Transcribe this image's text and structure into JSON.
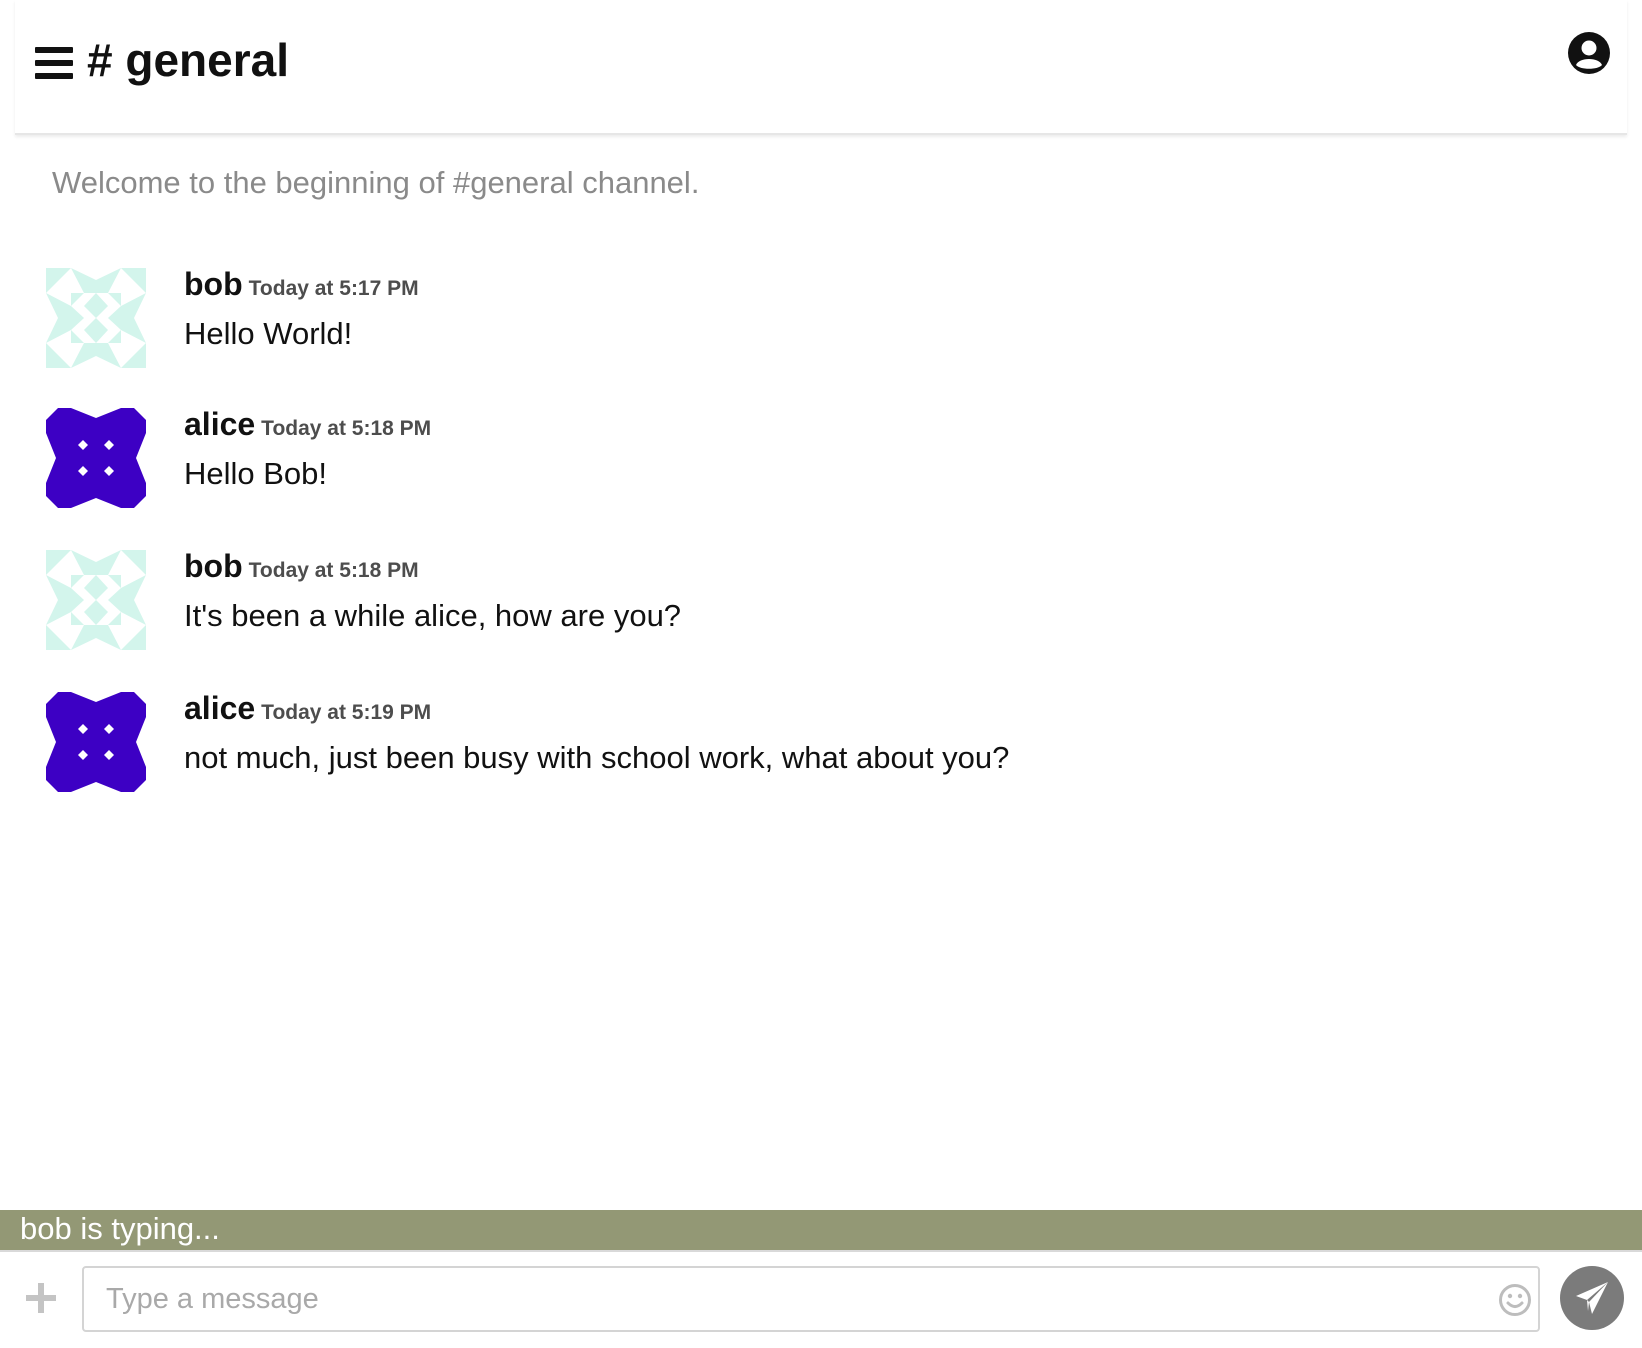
{
  "header": {
    "channel_title": "# general",
    "menu_icon": "hamburger-menu-icon",
    "account_icon": "user-circle-icon"
  },
  "welcome_text": "Welcome to the beginning of #general channel.",
  "messages": [
    {
      "author": "bob",
      "timestamp": "Today at 5:17 PM",
      "text": "Hello World!",
      "avatar": "identicon-bob"
    },
    {
      "author": "alice",
      "timestamp": "Today at 5:18 PM",
      "text": "Hello Bob!",
      "avatar": "identicon-alice"
    },
    {
      "author": "bob",
      "timestamp": "Today at 5:18 PM",
      "text": "It's been a while alice, how are you?",
      "avatar": "identicon-bob"
    },
    {
      "author": "alice",
      "timestamp": "Today at 5:19 PM",
      "text": "not much, just been busy with school work, what about you?",
      "avatar": "identicon-alice"
    }
  ],
  "typing_indicator": "bob is typing...",
  "composer": {
    "placeholder": "Type a message",
    "value": "",
    "add_icon": "plus-icon",
    "emoji_icon": "smiley-icon",
    "send_icon": "paper-plane-icon"
  },
  "colors": {
    "typing_bar": "#939875",
    "alice_avatar": "#3d00c4",
    "bob_avatar": "#d3f5ec",
    "send_button": "#7b7b7b"
  }
}
